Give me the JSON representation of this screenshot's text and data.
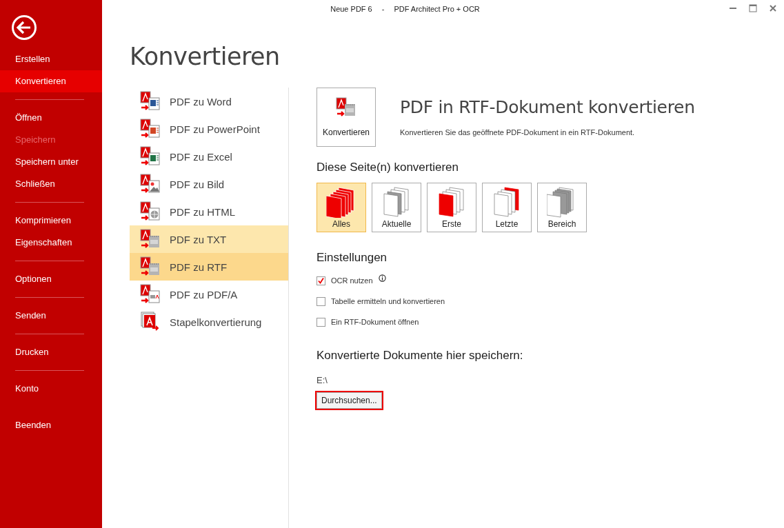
{
  "window": {
    "document": "Neue PDF 6",
    "separator": "-",
    "app": "PDF Architect Pro + OCR"
  },
  "sidebar": {
    "groups": [
      {
        "items": [
          {
            "label": "Erstellen",
            "selected": false,
            "disabled": false
          },
          {
            "label": "Konvertieren",
            "selected": true,
            "disabled": false
          }
        ]
      },
      {
        "items": [
          {
            "label": "Öffnen",
            "selected": false,
            "disabled": false
          },
          {
            "label": "Speichern",
            "selected": false,
            "disabled": true
          },
          {
            "label": "Speichern unter",
            "selected": false,
            "disabled": false
          },
          {
            "label": "Schließen",
            "selected": false,
            "disabled": false
          }
        ]
      },
      {
        "items": [
          {
            "label": "Komprimieren",
            "selected": false,
            "disabled": false
          },
          {
            "label": "Eigenschaften",
            "selected": false,
            "disabled": false
          }
        ]
      },
      {
        "items": [
          {
            "label": "Optionen",
            "selected": false,
            "disabled": false
          }
        ]
      },
      {
        "items": [
          {
            "label": "Senden",
            "selected": false,
            "disabled": false
          }
        ]
      },
      {
        "items": [
          {
            "label": "Drucken",
            "selected": false,
            "disabled": false
          }
        ]
      },
      {
        "items": [
          {
            "label": "Konto",
            "selected": false,
            "disabled": false
          },
          {
            "label": "Beenden",
            "selected": false,
            "disabled": false
          }
        ]
      }
    ]
  },
  "heading": "Konvertieren",
  "conversions": [
    {
      "kind": "word",
      "label": "PDF zu Word",
      "selected": false,
      "hovered": false
    },
    {
      "kind": "powerpoint",
      "label": "PDF zu PowerPoint",
      "selected": false,
      "hovered": false
    },
    {
      "kind": "excel",
      "label": "PDF zu Excel",
      "selected": false,
      "hovered": false
    },
    {
      "kind": "image",
      "label": "PDF zu Bild",
      "selected": false,
      "hovered": false
    },
    {
      "kind": "html",
      "label": "PDF zu HTML",
      "selected": false,
      "hovered": false
    },
    {
      "kind": "txt",
      "label": "PDF zu TXT",
      "selected": false,
      "hovered": true
    },
    {
      "kind": "rtf",
      "label": "PDF zu RTF",
      "selected": true,
      "hovered": false
    },
    {
      "kind": "pdfa",
      "label": "PDF zu PDF/A",
      "selected": false,
      "hovered": false
    },
    {
      "kind": "batch",
      "label": "Stapelkonvertierung",
      "selected": false,
      "hovered": false
    }
  ],
  "panel": {
    "convert_button": "Konvertieren",
    "title": "PDF in RTF-Dokument konvertieren",
    "description": "Konvertieren Sie das geöffnete PDF-Dokument in ein RTF-Dokument.",
    "pages_heading": "Diese Seite(n) konvertieren",
    "pages": [
      {
        "kind": "all",
        "label": "Alles",
        "selected": true
      },
      {
        "kind": "current",
        "label": "Aktuelle",
        "selected": false
      },
      {
        "kind": "first",
        "label": "Erste",
        "selected": false
      },
      {
        "kind": "last",
        "label": "Letzte",
        "selected": false
      },
      {
        "kind": "range",
        "label": "Bereich",
        "selected": false
      }
    ],
    "settings_heading": "Einstellungen",
    "settings": [
      {
        "label": "OCR nutzen",
        "checked": true,
        "info_icon": true
      },
      {
        "label": "Tabelle ermitteln und konvertieren",
        "checked": false
      },
      {
        "label": "Ein RTF-Dokument öffnen",
        "checked": false
      }
    ],
    "save_heading": "Konvertierte Dokumente hier speichern:",
    "save_path": "E:\\",
    "browse_button": "Durchsuchen...",
    "browse_focused": true
  }
}
